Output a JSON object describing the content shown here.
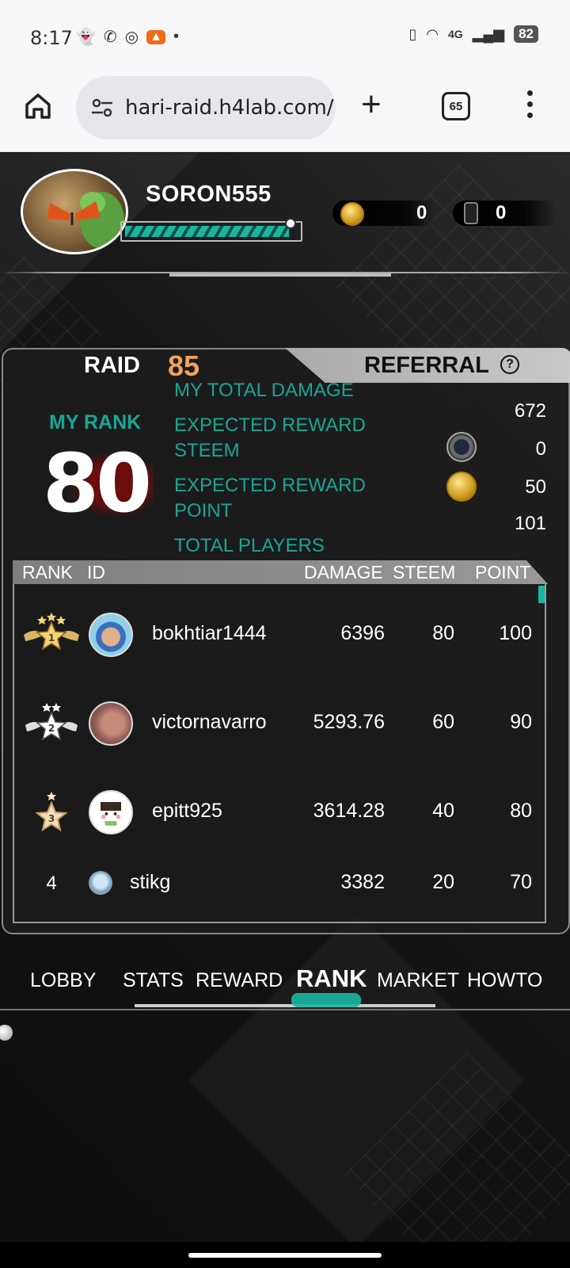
{
  "status_bar": {
    "time": "8:17",
    "battery": "82",
    "network": "4G"
  },
  "browser": {
    "url": "hari-raid.h4lab.com/",
    "tab_count": "65"
  },
  "profile": {
    "username": "SORON555",
    "coin_count": "0",
    "ticket_count": "0",
    "xp_progress_percent": 95
  },
  "panel": {
    "tab_raid": "RAID",
    "raid_count": "85",
    "tab_referral": "REFERRAL",
    "referral_help": "?",
    "my_rank_label": "MY RANK",
    "my_rank_value": "80",
    "stats": {
      "total_damage_label": "MY TOTAL DAMAGE",
      "total_damage_value": "672",
      "reward_steem_label_1": "EXPECTED REWARD",
      "reward_steem_label_2": "STEEM",
      "reward_steem_value": "0",
      "reward_point_label_1": "EXPECTED REWARD",
      "reward_point_label_2": "POINT",
      "reward_point_value": "50",
      "total_players_label": "TOTAL PLAYERS",
      "total_players_value": "101"
    }
  },
  "table": {
    "headers": {
      "rank": "RANK",
      "id": "ID",
      "damage": "DAMAGE",
      "steem": "STEEM",
      "point": "POINT"
    },
    "rows": [
      {
        "rank": "1",
        "id": "bokhtiar1444",
        "damage": "6396",
        "steem": "80",
        "point": "100"
      },
      {
        "rank": "2",
        "id": "victornavarro",
        "damage": "5293.76",
        "steem": "60",
        "point": "90"
      },
      {
        "rank": "3",
        "id": "epitt925",
        "damage": "3614.28",
        "steem": "40",
        "point": "80"
      },
      {
        "rank": "4",
        "id": "stikg",
        "damage": "3382",
        "steem": "20",
        "point": "70"
      }
    ]
  },
  "nav": {
    "items": [
      "LOBBY",
      "STATS",
      "REWARD",
      "RANK",
      "MARKET",
      "HOWTO"
    ],
    "active": "RANK"
  },
  "colors": {
    "accent_teal": "#1aa596",
    "raid_orange": "#f0a35e",
    "panel_border": "#888888"
  }
}
